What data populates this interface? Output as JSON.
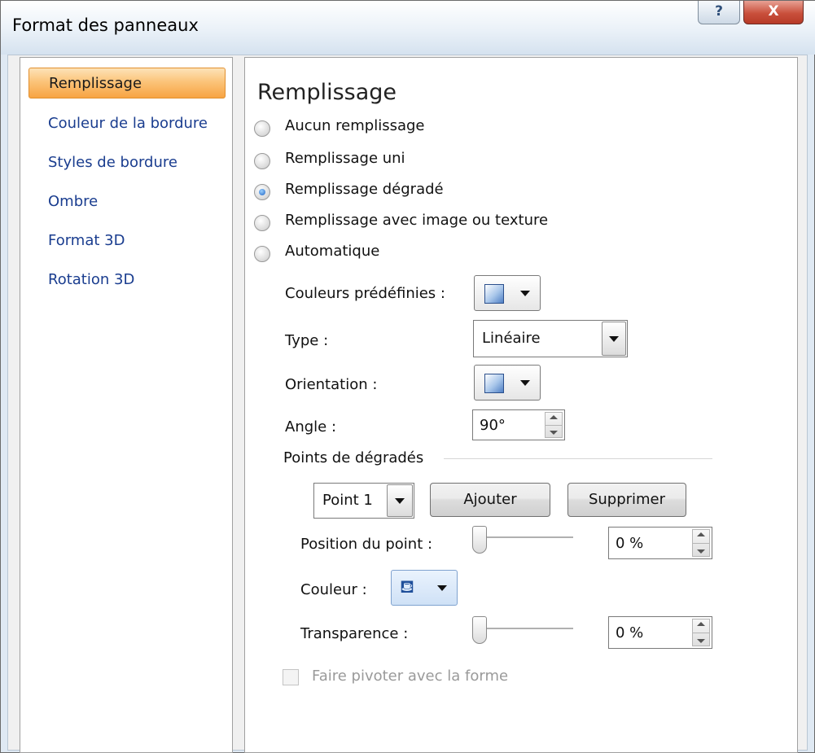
{
  "window": {
    "title": "Format des panneaux",
    "help_label": "?",
    "close_label": "X"
  },
  "nav": {
    "items": [
      {
        "label": "Remplissage",
        "selected": true
      },
      {
        "label": "Couleur de la bordure",
        "selected": false
      },
      {
        "label": "Styles de bordure",
        "selected": false
      },
      {
        "label": "Ombre",
        "selected": false
      },
      {
        "label": "Format 3D",
        "selected": false
      },
      {
        "label": "Rotation 3D",
        "selected": false
      }
    ]
  },
  "panel": {
    "heading": "Remplissage",
    "fill_options": [
      {
        "label": "Aucun remplissage",
        "selected": false
      },
      {
        "label": "Remplissage uni",
        "selected": false
      },
      {
        "label": "Remplissage dégradé",
        "selected": true
      },
      {
        "label": "Remplissage avec image ou texture",
        "selected": false
      },
      {
        "label": "Automatique",
        "selected": false
      }
    ],
    "preset_colors_label": "Couleurs prédéfinies :",
    "type_label": "Type :",
    "type_value": "Linéaire",
    "orientation_label": "Orientation :",
    "angle_label": "Angle :",
    "angle_value": "90°",
    "gradient_stops_label": "Points de dégradés",
    "stop_value": "Point 1",
    "add_button": "Ajouter",
    "remove_button": "Supprimer",
    "position_label": "Position du point :",
    "position_value": "0 %",
    "position_level": 0,
    "color_label": "Couleur :",
    "transparency_label": "Transparence :",
    "transparency_value": "0 %",
    "transparency_level": 0,
    "rotate_with_shape_label": "Faire pivoter avec la forme",
    "rotate_with_shape_checked": false
  }
}
